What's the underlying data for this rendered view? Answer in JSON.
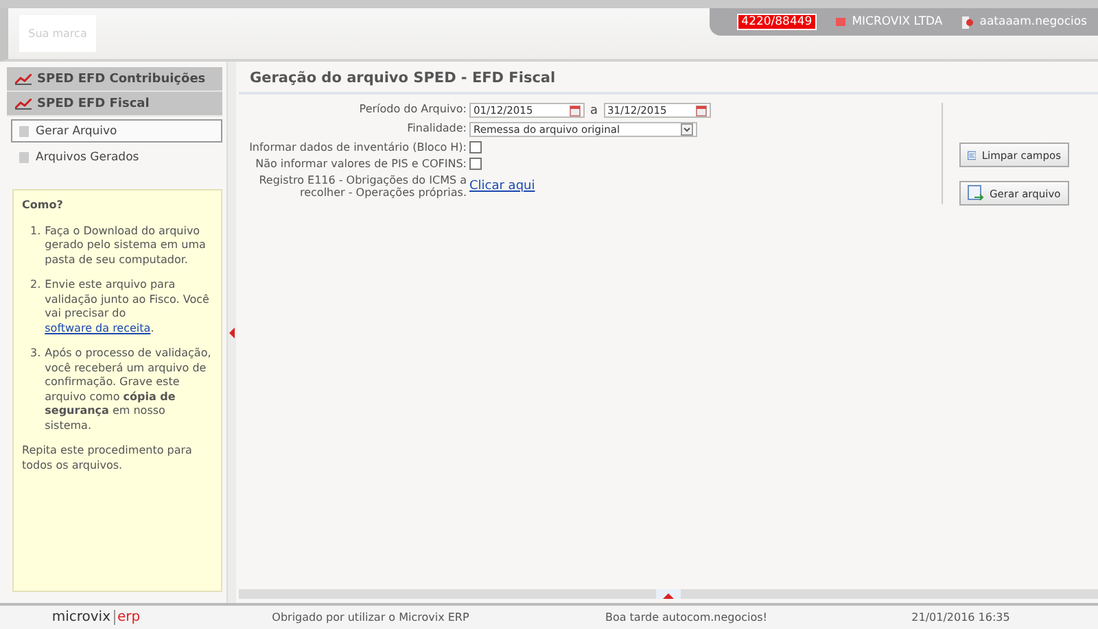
{
  "header": {
    "brand": "Sua marca",
    "counter": "4220/88449",
    "company": "MICROVIX LTDA",
    "user": "aataaam.negocios"
  },
  "sidebar": {
    "groups": [
      {
        "label": "SPED EFD Contribuições"
      },
      {
        "label": "SPED EFD Fiscal"
      }
    ],
    "items": [
      {
        "label": "Gerar Arquivo",
        "selected": true
      },
      {
        "label": "Arquivos Gerados",
        "selected": false
      }
    ],
    "help": {
      "title": "Como?",
      "steps": [
        {
          "marker": "1.",
          "text": "Faça o Download do arquivo gerado pelo sistema em uma pasta de seu computador."
        },
        {
          "marker": "2.",
          "text": "Envie este arquivo para validação junto ao Fisco. Você vai precisar do ",
          "link": "software da receita",
          "after": "."
        },
        {
          "marker": "3.",
          "text": "Após o processo de validação, você receberá um arquivo de confirmação. Grave este arquivo como **cópia de segurança** em nosso sistema."
        }
      ],
      "footer": "Repita este procedimento para todos os arquivos."
    }
  },
  "main": {
    "title": "Geração do arquivo SPED - EFD Fiscal",
    "fields": [
      {
        "kind": "daterange",
        "label": "Período do Arquivo:",
        "from": "01/12/2015",
        "separator": "a",
        "to": "31/12/2015"
      },
      {
        "kind": "select",
        "label": "Finalidade:",
        "value": "Remessa do arquivo original"
      },
      {
        "kind": "checkbox",
        "label": "Informar dados de inventário (Bloco H):",
        "checked": false
      },
      {
        "kind": "checkbox",
        "label": "Não informar valores de PIS e COFINS:",
        "checked": false
      },
      {
        "kind": "link",
        "label": "Registro E116 - Obrigações do ICMS a recolher - Operações próprias.",
        "link": "Clicar aqui"
      }
    ],
    "buttons": [
      {
        "kind": "clear",
        "label": "Limpar campos"
      },
      {
        "kind": "generate",
        "label": "Gerar arquivo"
      }
    ]
  },
  "footer": {
    "logo_left": "microvix",
    "logo_right": "erp",
    "thanks": "Obrigado por utilizar o Microvix ERP",
    "greeting": "Boa tarde autocom.negocios!",
    "datetime": "21/01/2016 16:35"
  }
}
